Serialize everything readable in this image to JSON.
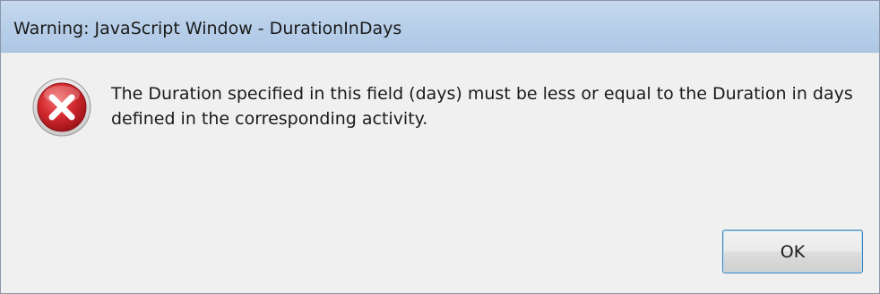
{
  "window": {
    "title": "Warning: JavaScript Window - DurationInDays"
  },
  "dialog": {
    "icon": "error-icon",
    "message": "The Duration specified in this field (days) must be less or equal to the Duration in days defined in the corresponding activity.",
    "ok_label": "OK"
  },
  "colors": {
    "titlebar": "#b9d0ea",
    "body": "#f0f0f0",
    "error_red": "#c8242c",
    "button_border": "#3c7fb1"
  }
}
